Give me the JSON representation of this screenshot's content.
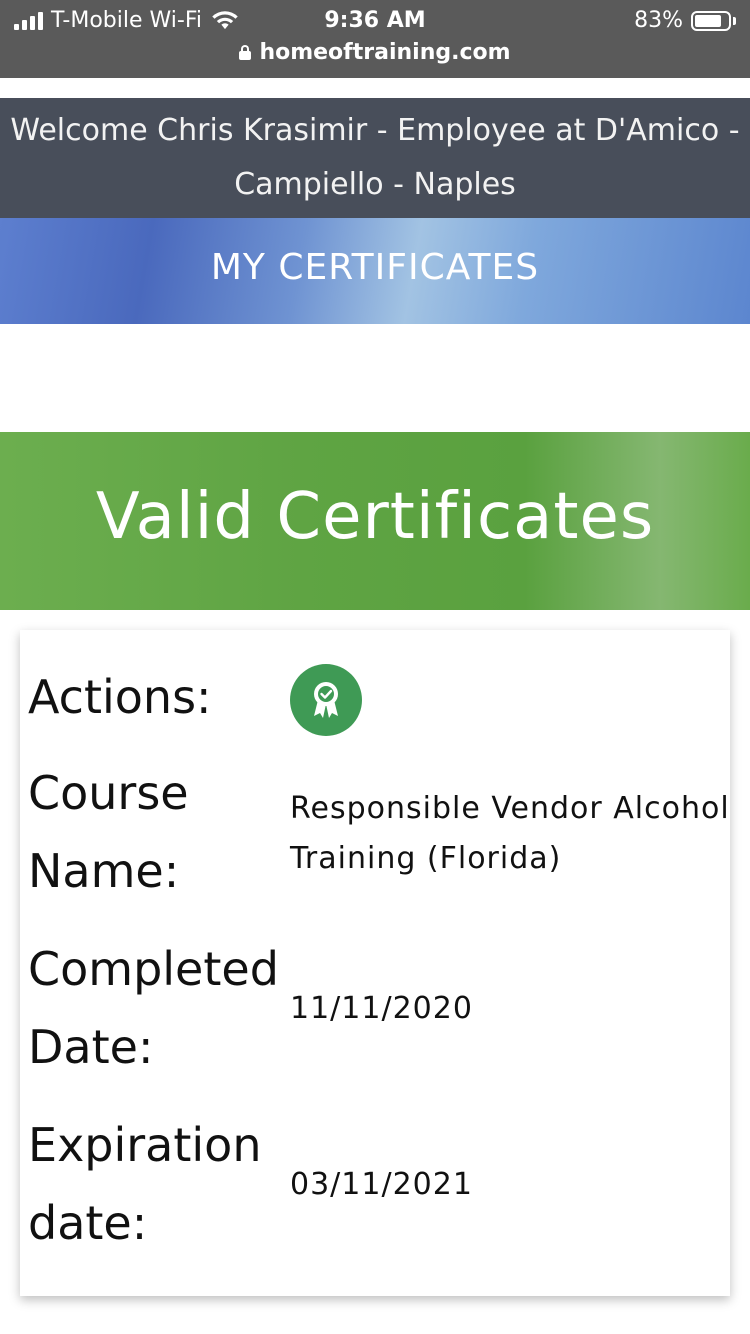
{
  "status_bar": {
    "carrier": "T-Mobile Wi-Fi",
    "time": "9:36 AM",
    "battery": "83%",
    "battery_level": 0.83,
    "url": "homeoftraining.com"
  },
  "header": {
    "welcome_line1": "Welcome Chris Krasimir - Employee at D'Amico -",
    "welcome_line2": "Campiello - Naples",
    "section_title": "MY CERTIFICATES"
  },
  "valid_section": {
    "title": "Valid Certificates"
  },
  "certificate": {
    "actions_label": "Actions:",
    "action_icon": "award-ribbon-icon",
    "course_label_1": "Course",
    "course_label_2": "Name:",
    "course_name_1": "Responsible Vendor Alcohol",
    "course_name_2": "Training (Florida)",
    "completed_label_1": "Completed",
    "completed_label_2": "Date:",
    "completed_date": "11/11/2020",
    "expiration_label_1": "Expiration",
    "expiration_label_2": "date:",
    "expiration_date": "03/11/2021"
  }
}
